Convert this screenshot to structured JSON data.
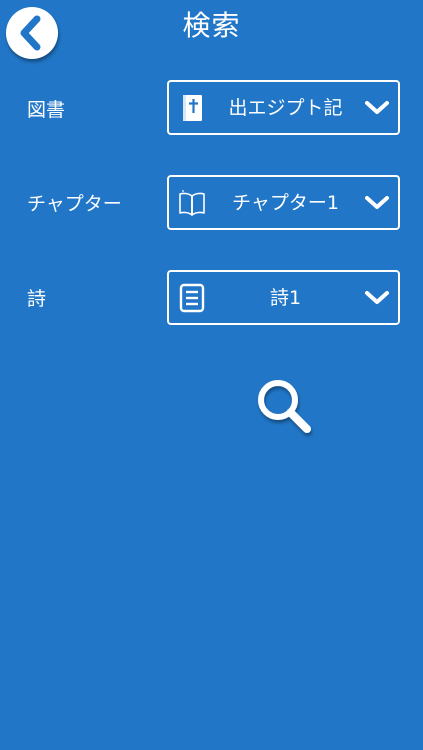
{
  "header": {
    "title": "検索",
    "back_icon": "chevron-left-icon"
  },
  "form": {
    "book": {
      "label": "図書",
      "value": "出エジプト記",
      "icon": "bible-icon"
    },
    "chapter": {
      "label": "チャプター",
      "value": "チャプター1",
      "icon": "open-book-icon"
    },
    "verse": {
      "label": "詩",
      "value": "詩1",
      "icon": "document-lines-icon"
    },
    "dropdown_icon": "chevron-down-icon"
  },
  "search": {
    "icon": "search-icon"
  },
  "colors": {
    "background": "#2176c7",
    "foreground": "#ffffff",
    "accent": "#2176c7"
  }
}
